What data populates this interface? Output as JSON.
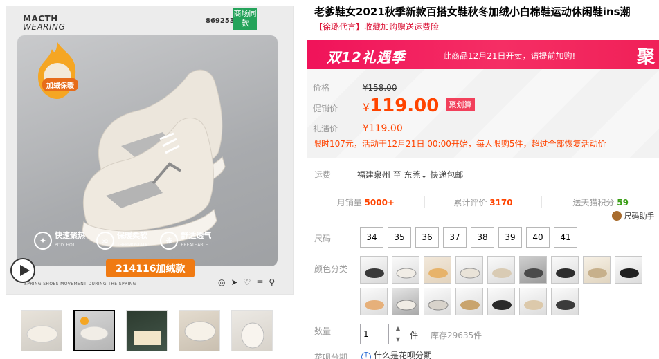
{
  "gallery": {
    "brand_line1": "MACTH",
    "brand_line2": "WEARING",
    "product_code": "869253",
    "same_badge": "商场同款",
    "warm_label": "加绒保暖",
    "features": [
      {
        "title": "快速聚热",
        "sub": "POLY HOT"
      },
      {
        "title": "保暖柔软",
        "sub": "THERMOSTATIC"
      },
      {
        "title": "舒适透气",
        "sub": "BREATHABLE"
      }
    ],
    "variant_banner": "214116加绒款",
    "tagline": "SPRING SHOES MOVEMENT DURING THE SPRING",
    "thumb_count": 5
  },
  "product": {
    "title": "老爹鞋女2021秋季新款百搭女鞋秋冬加绒小白棉鞋运动休闲鞋ins潮",
    "subtitle": "【徐璐代言】收藏加购赠送运费险"
  },
  "promo": {
    "logo": "双12礼遇季",
    "note": "此商品12月21日开卖，请提前加购!",
    "tag": "聚"
  },
  "pricing": {
    "original_label": "价格",
    "original_price": "¥158.00",
    "promo_label": "促销价",
    "promo_yen": "¥",
    "promo_amount": "119.00",
    "deal_tag": "聚划算",
    "gift_label": "礼遇价",
    "gift_price": "¥119.00",
    "limit_note": "限时107元，活动于12月21日 00:00开始，每人限购5件，超过全部恢复活动价"
  },
  "shipping": {
    "label": "运费",
    "from": "福建泉州",
    "to_prefix": "至",
    "to": "东莞",
    "method": "快递包邮"
  },
  "stats": {
    "monthly_label": "月销量",
    "monthly_value": "5000+",
    "reviews_label": "累计评价",
    "reviews_value": "3170",
    "points_label": "送天猫积分",
    "points_value": "59"
  },
  "size_helper": "尺码助手",
  "options": {
    "size_label": "尺码",
    "sizes": [
      "34",
      "35",
      "36",
      "37",
      "38",
      "39",
      "40",
      "41"
    ],
    "color_label": "颜色分类",
    "color_count": 16
  },
  "quantity": {
    "label": "数量",
    "value": "1",
    "unit": "件",
    "stock": "库存29635件"
  },
  "huabei": {
    "label": "花呗分期",
    "link": "什么是花呗分期"
  },
  "colors": {
    "accent": "#f40",
    "banner": "#f0135a",
    "green": "#24a35a"
  }
}
